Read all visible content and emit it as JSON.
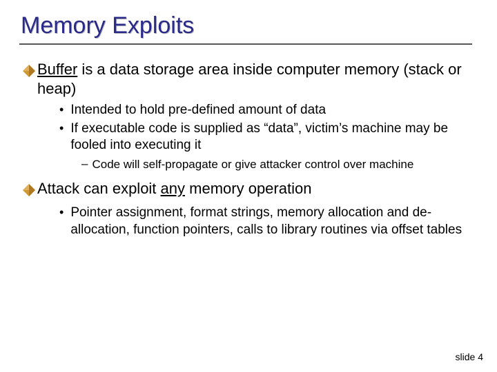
{
  "title": "Memory Exploits",
  "footer": "slide 4",
  "b1": {
    "underlined": "Buffer",
    "rest": " is a data storage area inside computer memory (stack or heap)",
    "sub1": "Intended to hold pre-defined amount of data",
    "sub2": "If executable code is supplied as “data”, victim’s machine may be fooled into executing it",
    "sub_sub": "Code will self-propagate or give attacker control over machine"
  },
  "b2": {
    "pre": "Attack can exploit ",
    "underlined": "any",
    "post": " memory operation",
    "sub1": "Pointer assignment, format strings, memory allocation and de-allocation, function pointers, calls to library routines via offset tables"
  }
}
